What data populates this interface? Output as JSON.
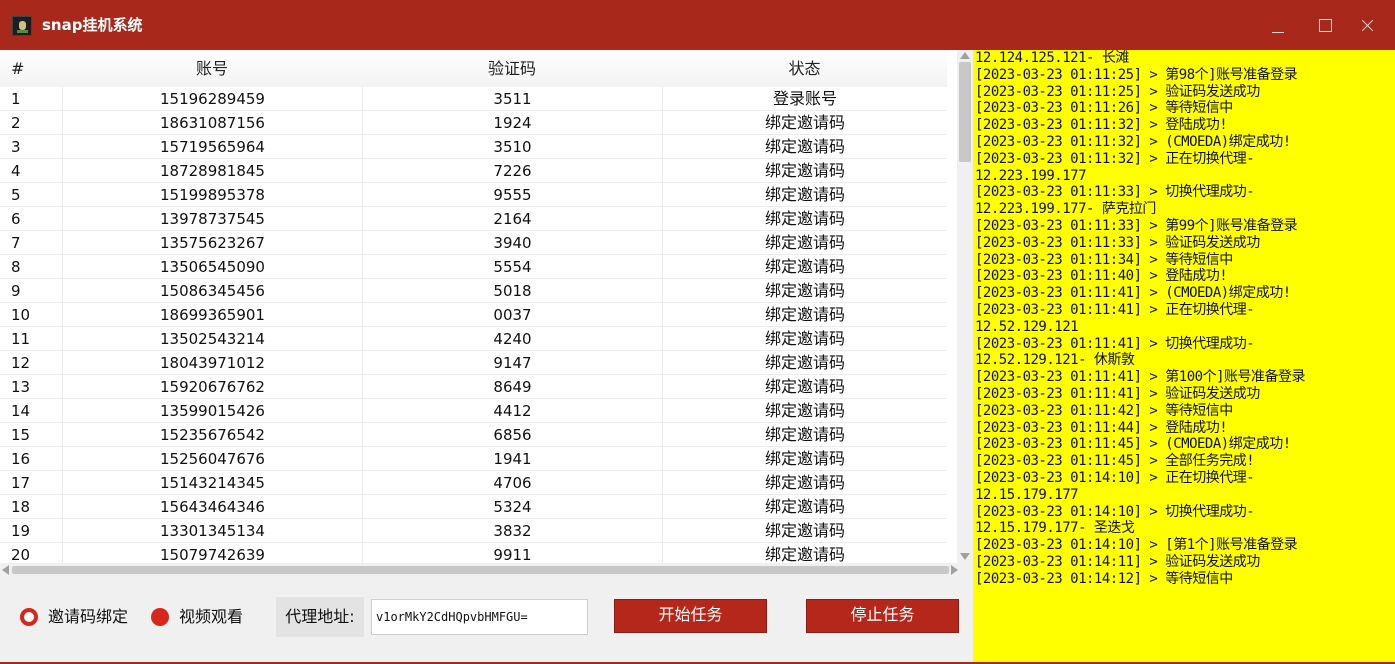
{
  "window": {
    "title": "snap挂机系统"
  },
  "table": {
    "headers": [
      "#",
      "账号",
      "验证码",
      "状态"
    ],
    "rows": [
      [
        "1",
        "15196289459",
        "3511",
        "登录账号"
      ],
      [
        "2",
        "18631087156",
        "1924",
        "绑定邀请码"
      ],
      [
        "3",
        "15719565964",
        "3510",
        "绑定邀请码"
      ],
      [
        "4",
        "18728981845",
        "7226",
        "绑定邀请码"
      ],
      [
        "5",
        "15199895378",
        "9555",
        "绑定邀请码"
      ],
      [
        "6",
        "13978737545",
        "2164",
        "绑定邀请码"
      ],
      [
        "7",
        "13575623267",
        "3940",
        "绑定邀请码"
      ],
      [
        "8",
        "13506545090",
        "5554",
        "绑定邀请码"
      ],
      [
        "9",
        "15086345456",
        "5018",
        "绑定邀请码"
      ],
      [
        "10",
        "18699365901",
        "0037",
        "绑定邀请码"
      ],
      [
        "11",
        "13502543214",
        "4240",
        "绑定邀请码"
      ],
      [
        "12",
        "18043971012",
        "9147",
        "绑定邀请码"
      ],
      [
        "13",
        "15920676762",
        "8649",
        "绑定邀请码"
      ],
      [
        "14",
        "13599015426",
        "4412",
        "绑定邀请码"
      ],
      [
        "15",
        "15235676542",
        "6856",
        "绑定邀请码"
      ],
      [
        "16",
        "15256047676",
        "1941",
        "绑定邀请码"
      ],
      [
        "17",
        "15143214345",
        "4706",
        "绑定邀请码"
      ],
      [
        "18",
        "15643464346",
        "5324",
        "绑定邀请码"
      ],
      [
        "19",
        "13301345134",
        "3832",
        "绑定邀请码"
      ],
      [
        "20",
        "15079742639",
        "9911",
        "绑定邀请码"
      ]
    ]
  },
  "controls": {
    "radio_invite": "邀请码绑定",
    "radio_video": "视频观看",
    "proxy_label": "代理地址:",
    "proxy_value": "v1orMkY2CdHQpvbHMFGU=",
    "start_button": "开始任务",
    "stop_button": "停止任务"
  },
  "log": {
    "lines": [
      "12.124.125.121- 长滩",
      "[2023-03-23 01:11:25] > 第98个]账号准备登录",
      "[2023-03-23 01:11:25] > 验证码发送成功",
      "[2023-03-23 01:11:26] > 等待短信中",
      "[2023-03-23 01:11:32] > 登陆成功!",
      "[2023-03-23 01:11:32] > (CMOEDA)绑定成功!",
      "[2023-03-23 01:11:32] > 正在切换代理-",
      "12.223.199.177",
      "[2023-03-23 01:11:33] > 切换代理成功-",
      "12.223.199.177- 萨克拉门",
      "[2023-03-23 01:11:33] > 第99个]账号准备登录",
      "[2023-03-23 01:11:33] > 验证码发送成功",
      "[2023-03-23 01:11:34] > 等待短信中",
      "[2023-03-23 01:11:40] > 登陆成功!",
      "[2023-03-23 01:11:41] > (CMOEDA)绑定成功!",
      "[2023-03-23 01:11:41] > 正在切换代理-",
      "12.52.129.121",
      "[2023-03-23 01:11:41] > 切换代理成功-",
      "12.52.129.121- 休斯敦",
      "[2023-03-23 01:11:41] > 第100个]账号准备登录",
      "[2023-03-23 01:11:41] > 验证码发送成功",
      "[2023-03-23 01:11:42] > 等待短信中",
      "[2023-03-23 01:11:44] > 登陆成功!",
      "[2023-03-23 01:11:45] > (CMOEDA)绑定成功!",
      "[2023-03-23 01:11:45] > 全部任务完成!",
      "[2023-03-23 01:14:10] > 正在切换代理-",
      "12.15.179.177",
      "[2023-03-23 01:14:10] > 切换代理成功-",
      "12.15.179.177- 圣迭戈",
      "[2023-03-23 01:14:10] > [第1个]账号准备登录",
      "[2023-03-23 01:14:11] > 验证码发送成功",
      "[2023-03-23 01:14:12] > 等待短信中"
    ]
  },
  "colors": {
    "titlebar": "#a8281c",
    "accent_button": "#b5271b",
    "log_background": "#ffff00"
  }
}
